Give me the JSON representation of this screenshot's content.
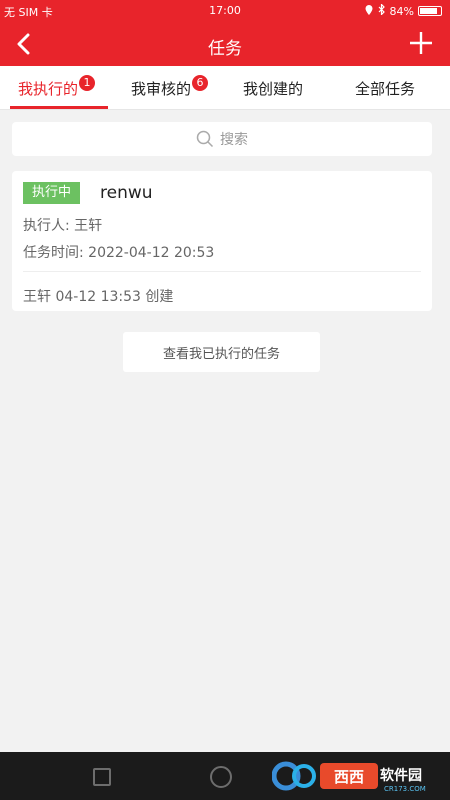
{
  "status_bar": {
    "carrier": "无 SIM 卡",
    "time": "17:00",
    "battery": "84%",
    "battery_level": 0.84
  },
  "nav": {
    "title": "任务",
    "back_icon": "chevron-left-icon",
    "add_icon": "plus-icon"
  },
  "tabs": [
    {
      "label": "我执行的",
      "badge": "1"
    },
    {
      "label": "我审核的",
      "badge": "6"
    },
    {
      "label": "我创建的",
      "badge": ""
    },
    {
      "label": "全部任务",
      "badge": ""
    }
  ],
  "search": {
    "placeholder": "搜索"
  },
  "task": {
    "status": "执行中",
    "name": "renwu",
    "assignee": "执行人: 王轩",
    "time": "任务时间: 2022-04-12 20:53",
    "created": "王轩 04-12 13:53 创建"
  },
  "view_button": "查看我已执行的任务",
  "watermark": {
    "text_cn": "西西软件园",
    "text_en": "CR173.COM"
  },
  "colors": {
    "accent": "#e8242b",
    "status_tag": "#6cc161"
  }
}
